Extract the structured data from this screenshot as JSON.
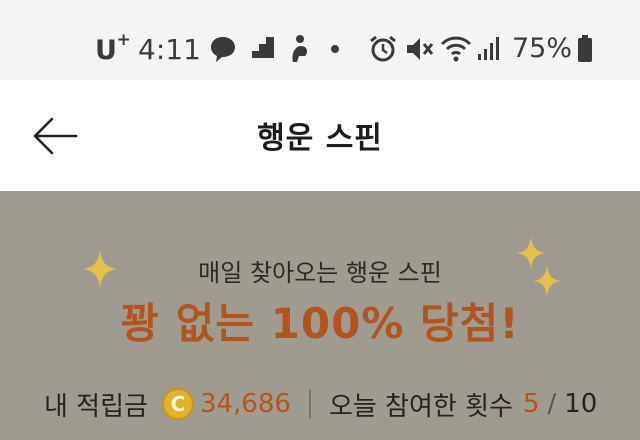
{
  "status_bar": {
    "carrier": "U",
    "carrier_sup": "+",
    "time": "4:11",
    "battery_percent": "75%",
    "icons": [
      "chat-icon",
      "stairs-icon",
      "person-icon",
      "dot-icon",
      "alarm-icon",
      "mute-icon",
      "wifi-icon",
      "signal-icon",
      "battery-icon"
    ]
  },
  "header": {
    "title": "행운 스핀",
    "back_icon": "arrow-left-icon"
  },
  "banner": {
    "subtitle": "매일 찾아오는 행운 스핀",
    "headline": "꽝 없는 100% 당첨!",
    "points_label": "내 적립금",
    "coin_symbol": "C",
    "points_value": "34,686",
    "count_label": "오늘 참여한 횟수",
    "count_current": "5",
    "count_separator": "/",
    "count_max": "10",
    "accent_color": "#b3541e",
    "background_color": "#a09b90",
    "sparkle_color": "#e3c04a"
  }
}
